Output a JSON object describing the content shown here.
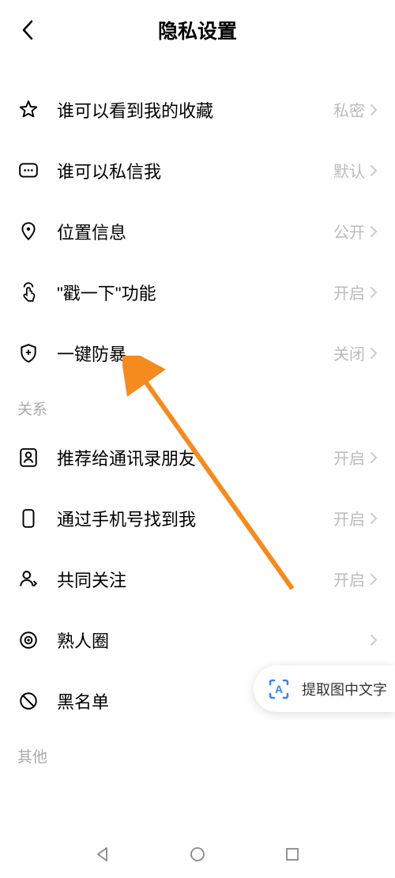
{
  "header": {
    "title": "隐私设置"
  },
  "settings": [
    {
      "icon": "star",
      "label": "谁可以看到我的收藏",
      "value": "私密"
    },
    {
      "icon": "message",
      "label": "谁可以私信我",
      "value": "默认"
    },
    {
      "icon": "location",
      "label": "位置信息",
      "value": "公开"
    },
    {
      "icon": "tap",
      "label": "\"戳一下\"功能",
      "value": "开启"
    },
    {
      "icon": "shield",
      "label": "一键防暴",
      "value": "关闭"
    }
  ],
  "section1": {
    "title": "关系"
  },
  "relations": [
    {
      "icon": "contact",
      "label": "推荐给通讯录朋友",
      "value": "开启"
    },
    {
      "icon": "phone",
      "label": "通过手机号找到我",
      "value": "开启"
    },
    {
      "icon": "mutual",
      "label": "共同关注",
      "value": "开启"
    },
    {
      "icon": "circle",
      "label": "熟人圈",
      "value": ""
    },
    {
      "icon": "block",
      "label": "黑名单",
      "value": ""
    }
  ],
  "section2": {
    "title": "其他"
  },
  "floating": {
    "label": "提取图中文字"
  }
}
